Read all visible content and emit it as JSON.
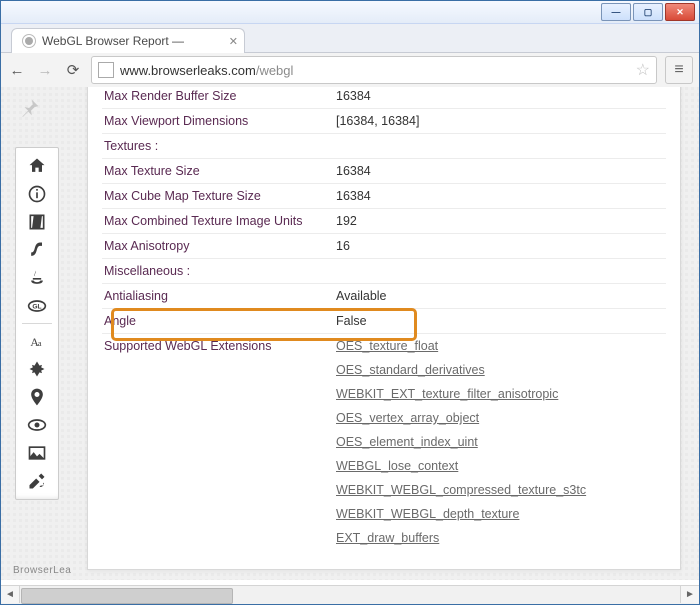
{
  "window": {
    "tab_title": "WebGL Browser Report — ",
    "url_host": "www.browserleaks.com",
    "url_path": "/webgl",
    "brand": "BrowserLea"
  },
  "sidebar_icons": [
    "home-icon",
    "info-icon",
    "javascript-icon",
    "flash-icon",
    "java-icon",
    "webgl-icon",
    "fonts-icon",
    "canvas-icon",
    "geolocation-icon",
    "detection-icon",
    "image-icon",
    "tools-icon"
  ],
  "rows": [
    {
      "label": "Max Render Buffer Size",
      "value": "16384"
    },
    {
      "label": "Max Viewport Dimensions",
      "value": "[16384, 16384]"
    }
  ],
  "section_textures": "Textures :",
  "texture_rows": [
    {
      "label": "Max Texture Size",
      "value": "16384"
    },
    {
      "label": "Max Cube Map Texture Size",
      "value": "16384"
    },
    {
      "label": "Max Combined Texture Image Units",
      "value": "192"
    },
    {
      "label": "Max Anisotropy",
      "value": "16"
    }
  ],
  "section_misc": "Miscellaneous :",
  "misc_rows": [
    {
      "label": "Antialiasing",
      "value": "Available"
    },
    {
      "label": "Angle",
      "value": "False"
    }
  ],
  "extensions_label": "Supported WebGL Extensions",
  "extensions": [
    "OES_texture_float",
    "OES_standard_derivatives",
    "WEBKIT_EXT_texture_filter_anisotropic",
    "OES_vertex_array_object",
    "OES_element_index_uint",
    "WEBGL_lose_context",
    "WEBKIT_WEBGL_compressed_texture_s3tc",
    "WEBKIT_WEBGL_depth_texture",
    "EXT_draw_buffers"
  ]
}
